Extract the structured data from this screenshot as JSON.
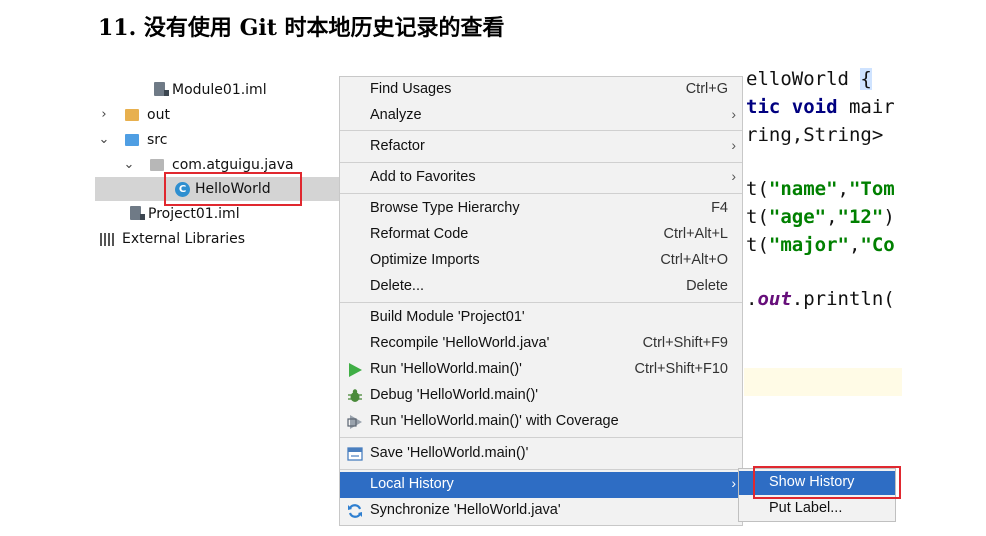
{
  "heading": "11. 没有使用 Git 时本地历史记录的查看",
  "tree": {
    "module_iml": "Module01.iml",
    "out": "out",
    "src": "src",
    "package": "com.atguigu.java",
    "class": "HelloWorld",
    "project_iml": "Project01.iml",
    "external": "External Libraries"
  },
  "editor": {
    "line1_a": "elloWorld ",
    "line1_b": "{",
    "line2_kw": "tic void ",
    "line2_rest": "mair",
    "line3": "ring,String>",
    "line4_a": "t(",
    "line4_s1": "\"name\"",
    "line4_c": ",",
    "line4_s2": "\"Tom",
    "line5_a": "t(",
    "line5_s1": "\"age\"",
    "line5_c": ",",
    "line5_s2": "\"12\"",
    "line5_e": ")",
    "line6_a": "t(",
    "line6_s1": "\"major\"",
    "line6_c": ",",
    "line6_s2": "\"Co",
    "line7_a": ".",
    "line7_f": "out",
    "line7_b": ".println("
  },
  "menu": {
    "find_usages": {
      "label": "Find Usages",
      "shortcut": "Ctrl+G"
    },
    "analyze": {
      "label": "Analyze"
    },
    "refactor": {
      "label": "Refactor"
    },
    "add_favorites": {
      "label": "Add to Favorites"
    },
    "browse_hierarchy": {
      "label": "Browse Type Hierarchy",
      "shortcut": "F4"
    },
    "reformat": {
      "label": "Reformat Code",
      "shortcut": "Ctrl+Alt+L"
    },
    "optimize": {
      "label": "Optimize Imports",
      "shortcut": "Ctrl+Alt+O"
    },
    "delete": {
      "label": "Delete...",
      "shortcut": "Delete"
    },
    "build_module": {
      "label": "Build Module 'Project01'"
    },
    "recompile": {
      "label": "Recompile 'HelloWorld.java'",
      "shortcut": "Ctrl+Shift+F9"
    },
    "run": {
      "label": "Run 'HelloWorld.main()'",
      "shortcut": "Ctrl+Shift+F10"
    },
    "debug": {
      "label": "Debug 'HelloWorld.main()'"
    },
    "coverage": {
      "label": "Run 'HelloWorld.main()' with Coverage"
    },
    "save": {
      "label": "Save 'HelloWorld.main()'"
    },
    "local_history": {
      "label": "Local History"
    },
    "synchronize": {
      "label": "Synchronize 'HelloWorld.java'"
    }
  },
  "submenu": {
    "show_history": "Show History",
    "put_label": "Put Label..."
  },
  "colors": {
    "selection": "#2e6dc4",
    "highlight_box": "#e0282f",
    "keyword": "#000080",
    "string": "#008000"
  }
}
